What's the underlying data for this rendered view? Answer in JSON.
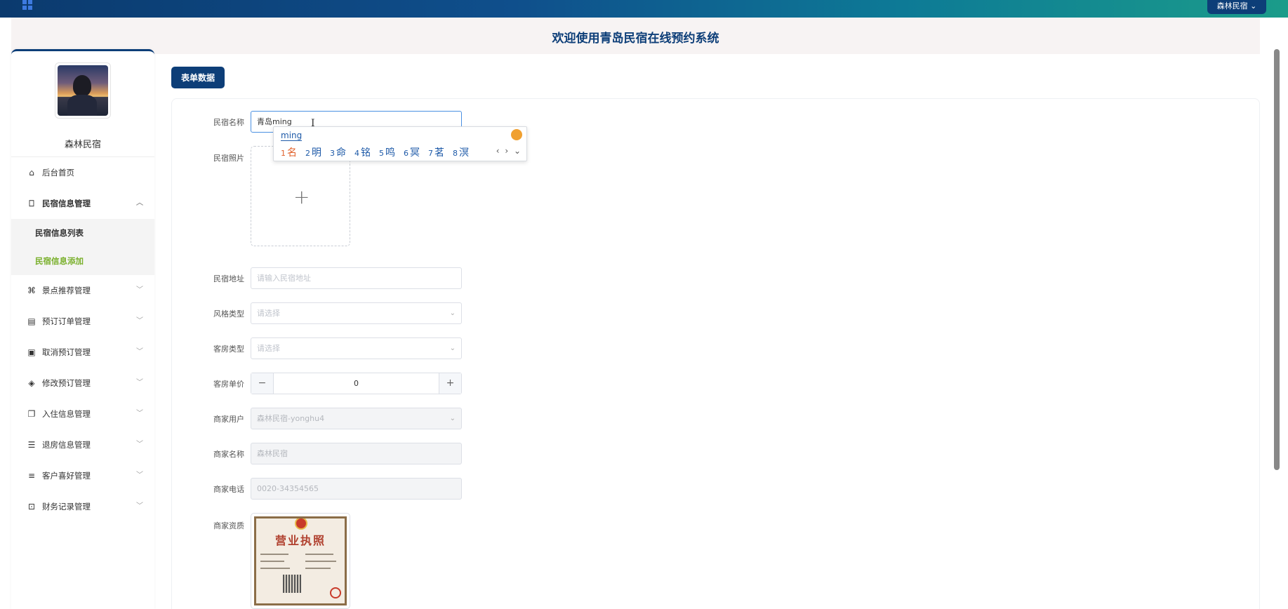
{
  "header": {
    "title": "欢迎使用青岛民宿在线预约系统",
    "user_menu": "森林民宿"
  },
  "sidebar": {
    "username": "森林民宿",
    "items": [
      {
        "label": "后台首页",
        "icon": "home-icon"
      },
      {
        "label": "民宿信息管理",
        "icon": "bookmark-icon"
      },
      {
        "label": "景点推荐管理",
        "icon": "tag-icon"
      },
      {
        "label": "预订订单管理",
        "icon": "message-icon"
      },
      {
        "label": "取消预订管理",
        "icon": "archive-icon"
      },
      {
        "label": "修改预订管理",
        "icon": "pill-icon"
      },
      {
        "label": "入住信息管理",
        "icon": "copy-icon"
      },
      {
        "label": "退房信息管理",
        "icon": "sliders-icon"
      },
      {
        "label": "客户喜好管理",
        "icon": "list-icon"
      },
      {
        "label": "财务记录管理",
        "icon": "safe-icon"
      }
    ],
    "submenu": [
      {
        "label": "民宿信息列表"
      },
      {
        "label": "民宿信息添加"
      }
    ]
  },
  "main": {
    "tab_label": "表单数据",
    "form": {
      "name_label": "民宿名称",
      "name_value": "青岛ming",
      "photo_label": "民宿照片",
      "address_label": "民宿地址",
      "address_placeholder": "请输入民宿地址",
      "style_label": "风格类型",
      "style_placeholder": "请选择",
      "room_type_label": "客房类型",
      "room_type_placeholder": "请选择",
      "price_label": "客房单价",
      "price_value": "0",
      "merchant_user_label": "商家用户",
      "merchant_user_value": "森林民宿-yonghu4",
      "merchant_name_label": "商家名称",
      "merchant_name_value": "森林民宿",
      "merchant_phone_label": "商家电话",
      "merchant_phone_value": "0020-34354565",
      "qualification_label": "商家资质",
      "license_title": "营业执照"
    }
  },
  "ime": {
    "composition": "ming",
    "candidates": [
      {
        "n": "1",
        "c": "名"
      },
      {
        "n": "2",
        "c": "明"
      },
      {
        "n": "3",
        "c": "命"
      },
      {
        "n": "4",
        "c": "铭"
      },
      {
        "n": "5",
        "c": "鸣"
      },
      {
        "n": "6",
        "c": "冥"
      },
      {
        "n": "7",
        "c": "茗"
      },
      {
        "n": "8",
        "c": "溟"
      }
    ]
  }
}
